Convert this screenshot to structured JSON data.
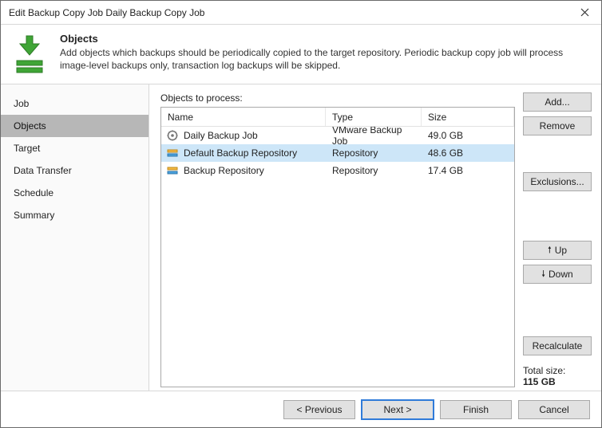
{
  "window": {
    "title": "Edit Backup Copy Job Daily Backup Copy Job"
  },
  "banner": {
    "title": "Objects",
    "description": "Add objects which backups should be periodically copied to the target repository. Periodic backup copy job will process image-level backups only, transaction log backups will be skipped."
  },
  "sidebar": {
    "items": [
      {
        "label": "Job"
      },
      {
        "label": "Objects"
      },
      {
        "label": "Target"
      },
      {
        "label": "Data Transfer"
      },
      {
        "label": "Schedule"
      },
      {
        "label": "Summary"
      }
    ],
    "active_index": 1
  },
  "section": {
    "label": "Objects to process:"
  },
  "columns": {
    "name": "Name",
    "type": "Type",
    "size": "Size"
  },
  "rows": [
    {
      "icon": "gear-icon",
      "name": "Daily Backup Job",
      "type": "VMware Backup Job",
      "size": "49.0 GB",
      "selected": false
    },
    {
      "icon": "repo-default-icon",
      "name": "Default Backup Repository",
      "type": "Repository",
      "size": "48.6 GB",
      "selected": true
    },
    {
      "icon": "repo-icon",
      "name": "Backup Repository",
      "type": "Repository",
      "size": "17.4 GB",
      "selected": false
    }
  ],
  "rail": {
    "add": "Add...",
    "remove": "Remove",
    "exclusions": "Exclusions...",
    "up": "Up",
    "down": "Down",
    "recalculate": "Recalculate"
  },
  "totals": {
    "label": "Total size:",
    "value": "115 GB"
  },
  "footer": {
    "previous": "< Previous",
    "next": "Next >",
    "finish": "Finish",
    "cancel": "Cancel"
  }
}
